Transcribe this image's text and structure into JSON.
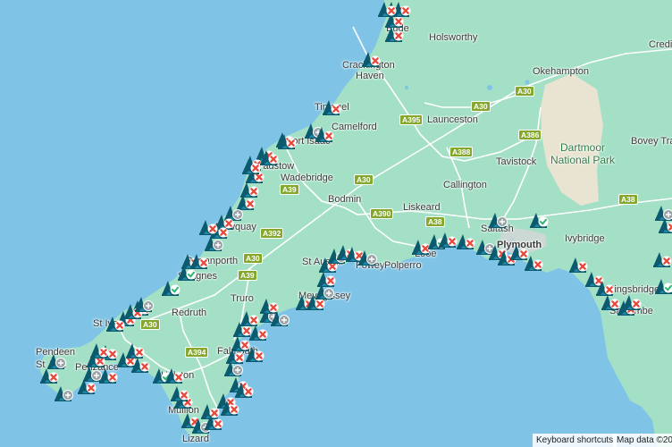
{
  "places": [
    {
      "id": "bude",
      "text": "Bude"
    },
    {
      "id": "holsworthy",
      "text": "Holsworthy"
    },
    {
      "id": "crackington",
      "text": "Crackington"
    },
    {
      "id": "haven",
      "text": "Haven"
    },
    {
      "id": "okehampton",
      "text": "Okehampton"
    },
    {
      "id": "credi",
      "text": "Credi"
    },
    {
      "id": "tintagel",
      "text": "Tintagel"
    },
    {
      "id": "camelford",
      "text": "Camelford"
    },
    {
      "id": "launceston",
      "text": "Launceston"
    },
    {
      "id": "port-isaac",
      "text": "Port Isaac"
    },
    {
      "id": "tavistock",
      "text": "Tavistock"
    },
    {
      "id": "dartmoor",
      "text": "Dartmoor\nNational Park"
    },
    {
      "id": "bovey",
      "text": "Bovey Tra"
    },
    {
      "id": "padstow",
      "text": "Padstow"
    },
    {
      "id": "wadebridge",
      "text": "Wadebridge"
    },
    {
      "id": "bodmin",
      "text": "Bodmin"
    },
    {
      "id": "callington",
      "text": "Callington"
    },
    {
      "id": "newquay",
      "text": "Newquay"
    },
    {
      "id": "liskeard",
      "text": "Liskeard"
    },
    {
      "id": "saltash",
      "text": "Saltash"
    },
    {
      "id": "plymouth",
      "text": "Plymouth"
    },
    {
      "id": "ivybridge",
      "text": "Ivybridge"
    },
    {
      "id": "perranporth",
      "text": "Perranporth"
    },
    {
      "id": "st-agnes",
      "text": "St Agnes"
    },
    {
      "id": "st-austell",
      "text": "St Austell"
    },
    {
      "id": "fowey",
      "text": "Fowey"
    },
    {
      "id": "polperro",
      "text": "Polperro"
    },
    {
      "id": "looe",
      "text": "Looe"
    },
    {
      "id": "truro",
      "text": "Truro"
    },
    {
      "id": "mevagissey",
      "text": "Mevagissey"
    },
    {
      "id": "kingsbridge",
      "text": "Kingsbridge"
    },
    {
      "id": "salcombe",
      "text": "Salcombe"
    },
    {
      "id": "redruth",
      "text": "Redruth"
    },
    {
      "id": "st-ives",
      "text": "St Ives"
    },
    {
      "id": "pendeen",
      "text": "Pendeen"
    },
    {
      "id": "st-just",
      "text": "St Just"
    },
    {
      "id": "penzance",
      "text": "Penzance"
    },
    {
      "id": "falmouth",
      "text": "Falmouth"
    },
    {
      "id": "helston",
      "text": "Helston"
    },
    {
      "id": "mullion",
      "text": "Mullion"
    },
    {
      "id": "lizard",
      "text": "Lizard"
    }
  ],
  "roads": [
    "A30",
    "A395",
    "A30",
    "A386",
    "A388",
    "A30",
    "A39",
    "A390",
    "A38",
    "A392",
    "A30",
    "A39",
    "A30",
    "A394",
    "A38"
  ],
  "footer": {
    "shortcuts": "Keyboard shortcuts",
    "mapdata": "Map data ©2024"
  },
  "markers": [
    {
      "status": "warn"
    },
    {
      "status": "warn"
    },
    {
      "status": "warn"
    },
    {
      "status": "warn"
    },
    {
      "status": "warn"
    },
    {
      "status": "info"
    },
    {
      "status": "warn"
    },
    {
      "status": "warn"
    },
    {
      "status": "warn"
    },
    {
      "status": "warn"
    },
    {
      "status": "warn"
    },
    {
      "status": "warn"
    },
    {
      "status": "info"
    },
    {
      "status": "warn"
    },
    {
      "status": "warn"
    },
    {
      "status": "info"
    },
    {
      "status": "warn"
    },
    {
      "status": "warn"
    },
    {
      "status": "ok"
    },
    {
      "status": "ok"
    },
    {
      "status": "warn"
    },
    {
      "status": "warn"
    },
    {
      "status": "warn"
    },
    {
      "status": "warn"
    },
    {
      "status": "warn"
    },
    {
      "status": "info"
    },
    {
      "status": "warn"
    },
    {
      "status": "warn"
    },
    {
      "status": "ok"
    },
    {
      "status": "warn"
    },
    {
      "status": "warn"
    },
    {
      "status": "info"
    },
    {
      "status": "warn"
    },
    {
      "status": "warn"
    },
    {
      "status": "warn"
    },
    {
      "status": "info"
    },
    {
      "status": "warn"
    },
    {
      "status": "warn"
    },
    {
      "status": "warn"
    },
    {
      "status": "warn"
    },
    {
      "status": "warn"
    },
    {
      "status": "info"
    },
    {
      "status": "info"
    },
    {
      "status": "warn"
    },
    {
      "status": "warn"
    },
    {
      "status": "info"
    },
    {
      "status": "warn"
    },
    {
      "status": "warn"
    },
    {
      "status": "info"
    },
    {
      "status": "warn"
    },
    {
      "status": "warn"
    },
    {
      "status": "info"
    },
    {
      "status": "warn"
    },
    {
      "status": "ok"
    },
    {
      "status": "warn"
    },
    {
      "status": "warn"
    },
    {
      "status": "info"
    },
    {
      "status": "warn"
    },
    {
      "status": "warn"
    },
    {
      "status": "warn"
    },
    {
      "status": "warn"
    },
    {
      "status": "ok"
    },
    {
      "status": "info"
    },
    {
      "status": "warn"
    },
    {
      "status": "warn"
    },
    {
      "status": "warn"
    },
    {
      "status": "warn"
    },
    {
      "status": "warn"
    },
    {
      "status": "warn"
    },
    {
      "status": "ok"
    },
    {
      "status": "info"
    },
    {
      "status": "warn"
    },
    {
      "status": "info"
    },
    {
      "status": "warn"
    },
    {
      "status": "info"
    },
    {
      "status": "warn"
    },
    {
      "status": "warn"
    },
    {
      "status": "info"
    },
    {
      "status": "warn"
    },
    {
      "status": "warn"
    },
    {
      "status": "warn"
    },
    {
      "status": "warn"
    },
    {
      "status": "warn"
    },
    {
      "status": "warn"
    },
    {
      "status": "warn"
    },
    {
      "status": "warn"
    },
    {
      "status": "warn"
    },
    {
      "status": "warn"
    },
    {
      "status": "warn"
    },
    {
      "status": "warn"
    },
    {
      "status": "warn"
    },
    {
      "status": "warn"
    },
    {
      "status": "warn"
    },
    {
      "status": "warn"
    },
    {
      "status": "warn"
    },
    {
      "status": "warn"
    }
  ],
  "colors": {
    "sea": "#7fc4e6",
    "land": "#9fdec4",
    "land_dark": "#c7e6c6",
    "moor": "#e8e3d4",
    "marker": "#0c5a6e",
    "warn": "#e8483b",
    "ok": "#2bb673",
    "info": "#9aa3a8"
  }
}
